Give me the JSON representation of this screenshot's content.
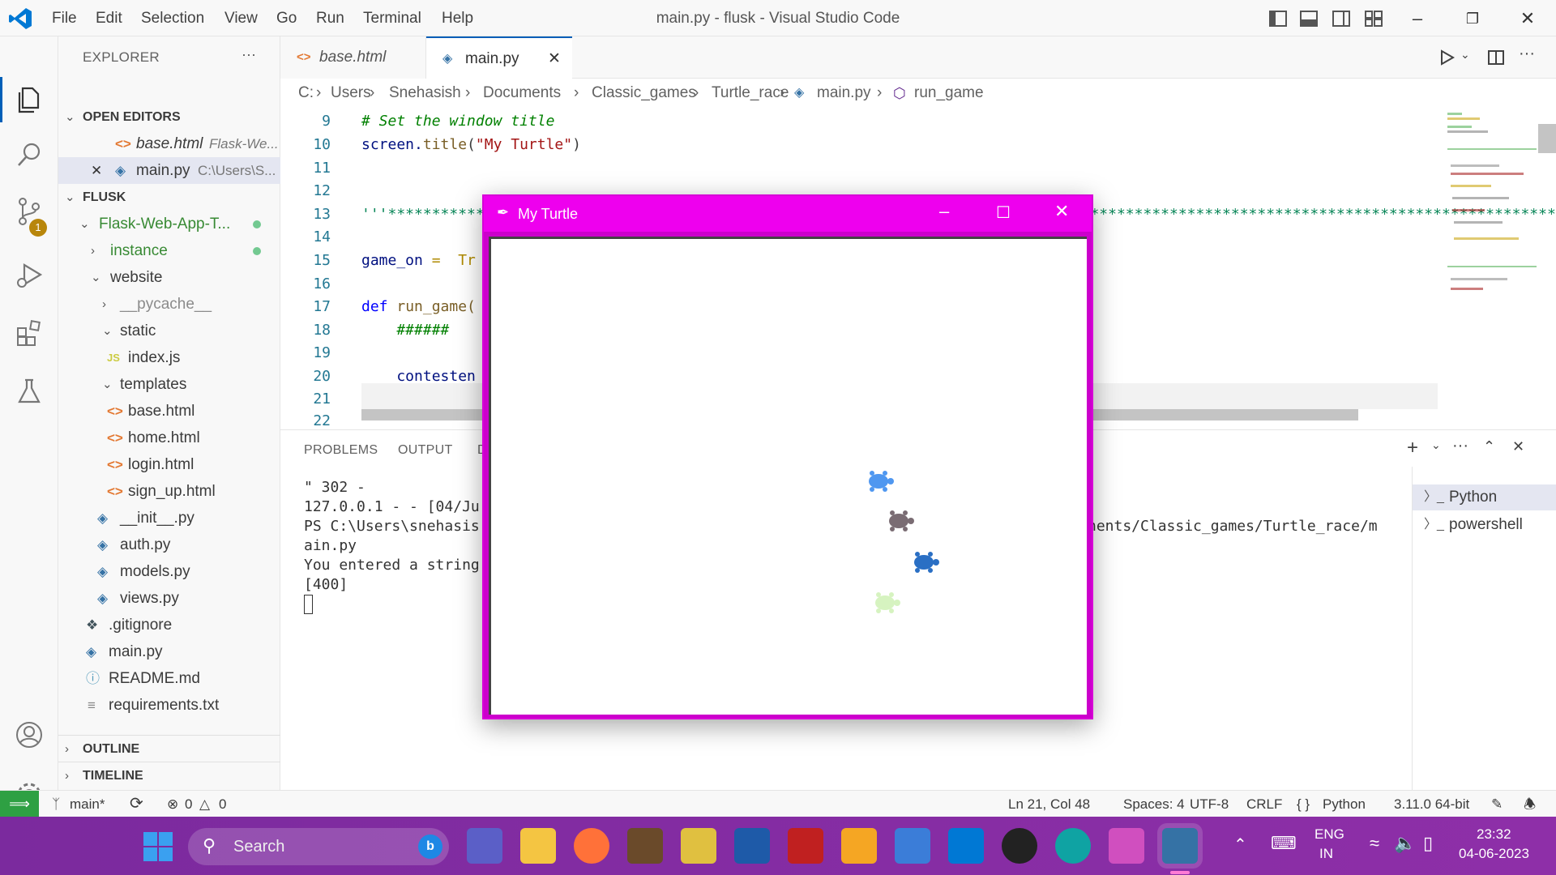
{
  "titlebar": {
    "menus": [
      "File",
      "Edit",
      "Selection",
      "View",
      "Go",
      "Run",
      "Terminal",
      "Help"
    ],
    "title": "main.py - flusk - Visual Studio Code"
  },
  "activity": {
    "source_control_badge": "1"
  },
  "sidebar": {
    "header": "EXPLORER",
    "more": "···",
    "open_editors_title": "OPEN EDITORS",
    "open_editors": [
      {
        "name": "base.html",
        "desc": "Flask-We..."
      },
      {
        "name": "main.py",
        "desc": "C:\\Users\\S..."
      }
    ],
    "workspace_title": "FLUSK",
    "tree": [
      {
        "label": "Flask-Web-App-T..."
      },
      {
        "label": "instance"
      },
      {
        "label": "website"
      },
      {
        "label": "__pycache__"
      },
      {
        "label": "static"
      },
      {
        "label": "index.js"
      },
      {
        "label": "templates"
      },
      {
        "label": "base.html"
      },
      {
        "label": "home.html"
      },
      {
        "label": "login.html"
      },
      {
        "label": "sign_up.html"
      },
      {
        "label": "__init__.py"
      },
      {
        "label": "auth.py"
      },
      {
        "label": "models.py"
      },
      {
        "label": "views.py"
      },
      {
        "label": ".gitignore"
      },
      {
        "label": "main.py"
      },
      {
        "label": "README.md"
      },
      {
        "label": "requirements.txt"
      }
    ],
    "outline_title": "OUTLINE",
    "timeline_title": "TIMELINE"
  },
  "tabs": [
    {
      "label": "base.html"
    },
    {
      "label": "main.py"
    }
  ],
  "breadcrumb": [
    "C:",
    "Users",
    "Snehasish",
    "Documents",
    "Classic_games",
    "Turtle_race",
    "main.py",
    "run_game"
  ],
  "editor": {
    "lines": [
      {
        "num": "9",
        "text": "# Set the window title"
      },
      {
        "num": "10",
        "text_a": "screen.",
        "text_b": "title",
        "text_c": "(",
        "text_d": "\"My Turtle\"",
        "text_e": ")"
      },
      {
        "num": "11",
        "text": ""
      },
      {
        "num": "12",
        "text": ""
      },
      {
        "num": "13",
        "text": "'''**********************************************************************************************************************************************"
      },
      {
        "num": "14",
        "text": ""
      },
      {
        "num": "15",
        "text_a": "game_on",
        "text_b": " =  Tr"
      },
      {
        "num": "16",
        "text": ""
      },
      {
        "num": "17",
        "text_a": "def",
        "text_b": " run_game("
      },
      {
        "num": "18",
        "text": "    ######"
      },
      {
        "num": "19",
        "text": ""
      },
      {
        "num": "20",
        "text": "    contesten"
      },
      {
        "num": "21",
        "text": ""
      },
      {
        "num": "22",
        "text": ""
      }
    ]
  },
  "panel": {
    "tabs": [
      "PROBLEMS",
      "OUTPUT",
      "D"
    ],
    "terminal_lines": [
      "\" 302 -",
      "127.0.0.1 - - [04/Ju",
      "PS C:\\Users\\snehasis",
      "ain.py",
      "You entered a string",
      "[400]"
    ],
    "terminal_right": "nents/Classic_games/Turtle_race/m",
    "terminals": [
      "Python",
      "powershell"
    ]
  },
  "statusbar": {
    "branch": "main*",
    "errors": "0",
    "warnings": "0",
    "position": "Ln 21, Col 48",
    "spaces": "Spaces: 4",
    "encoding": "UTF-8",
    "eol": "CRLF",
    "language": "Python",
    "interpreter": "3.11.0 64-bit"
  },
  "taskbar": {
    "search": "Search",
    "lang_top": "ENG",
    "lang_bottom": "IN",
    "time": "23:32",
    "date": "04-06-2023"
  },
  "turtle_window": {
    "title": "My Turtle",
    "turtles": [
      {
        "color": "#4f97f0"
      },
      {
        "color": "#7a6c73"
      },
      {
        "color": "#2a6fc4"
      },
      {
        "color": "#d6f3c0"
      }
    ]
  },
  "colors": {
    "accent": "#005fb8",
    "turtle_title": "#ee00ee",
    "remote": "#2ea043",
    "taskbar": "#7b2a9e"
  }
}
